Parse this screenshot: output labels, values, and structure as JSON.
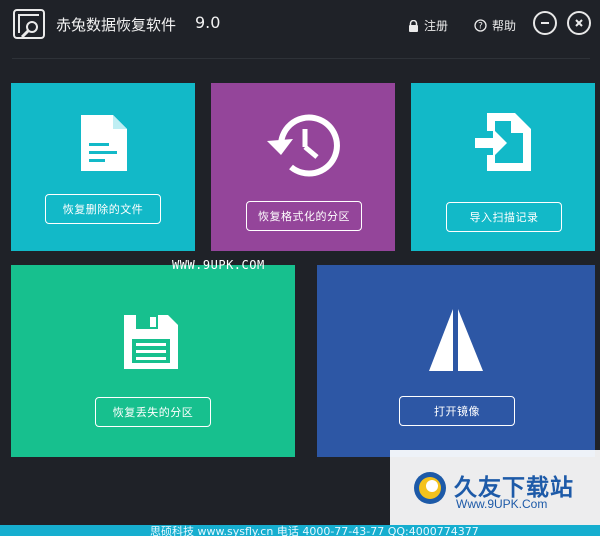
{
  "app": {
    "title": "赤兔数据恢复软件",
    "version": "9.0"
  },
  "toolbar": {
    "register_label": "注册",
    "help_label": "帮助"
  },
  "tiles": [
    {
      "id": "recover-deleted-files",
      "button_label": "恢复删除的文件",
      "color": "#12b9c8",
      "icon": "document-icon"
    },
    {
      "id": "recover-formatted-partition",
      "button_label": "恢复格式化的分区",
      "color": "#94459a",
      "icon": "history-clock-icon"
    },
    {
      "id": "import-scan-record",
      "button_label": "导入扫描记录",
      "color": "#12b9c8",
      "icon": "import-file-icon"
    },
    {
      "id": "recover-lost-partition",
      "button_label": "恢复丢失的分区",
      "color": "#17c08e",
      "icon": "floppy-disk-icon"
    },
    {
      "id": "open-image",
      "button_label": "打开镜像",
      "color": "#2d57a5",
      "icon": "sail-icon"
    }
  ],
  "watermark": {
    "site_text": "WWW.9UPK.COM",
    "brand_title": "久友下载站",
    "brand_url": "Www.9UPK.Com"
  },
  "footer": {
    "text": "思硕科技 www.sysfly.cn 电话 4000-77-43-77 QQ:4000774377"
  }
}
